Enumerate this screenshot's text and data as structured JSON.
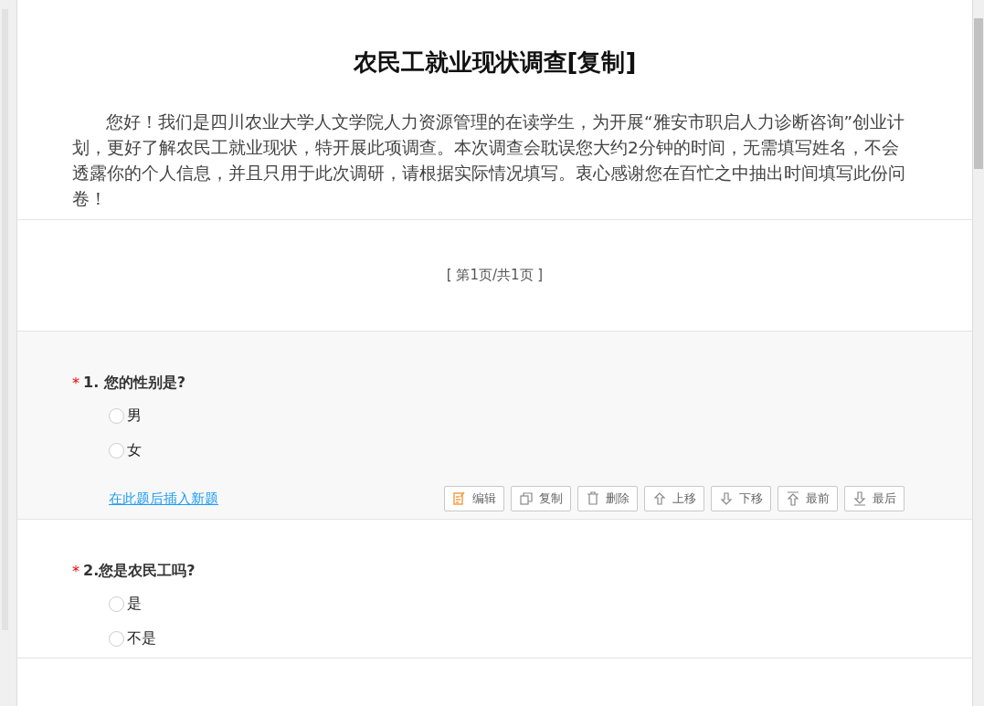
{
  "survey": {
    "title": "农民工就业现状调查[复制]",
    "intro": "您好！我们是四川农业大学人文学院人力资源管理的在读学生，为开展“雅安市职启人力诊断咨询”创业计划，更好了解农民工就业现状，特开展此项调查。本次调查会耽误您大约2分钟的时间，无需填写姓名，不会透露你的个人信息，并且只用于此次调研，请根据实际情况填写。衷心感谢您在百忙之中抽出时间填写此份问卷！",
    "pager": "[ 第1页/共1页 ]"
  },
  "questions": [
    {
      "required_mark": "*",
      "title": "1. 您的性别是?",
      "options": [
        {
          "label": "男",
          "selected": false
        },
        {
          "label": "女",
          "selected": false
        }
      ],
      "insert_link": "在此题后插入新题",
      "actions": [
        {
          "kind": "edit",
          "label": "编辑"
        },
        {
          "kind": "copy",
          "label": "复制"
        },
        {
          "kind": "delete",
          "label": "删除"
        },
        {
          "kind": "up",
          "label": "上移"
        },
        {
          "kind": "down",
          "label": "下移"
        },
        {
          "kind": "top",
          "label": "最前"
        },
        {
          "kind": "bottom",
          "label": "最后"
        }
      ]
    },
    {
      "required_mark": "*",
      "title": "2.您是农民工吗?",
      "options": [
        {
          "label": "是",
          "selected": false
        },
        {
          "label": "不是",
          "selected": false
        }
      ]
    }
  ]
}
